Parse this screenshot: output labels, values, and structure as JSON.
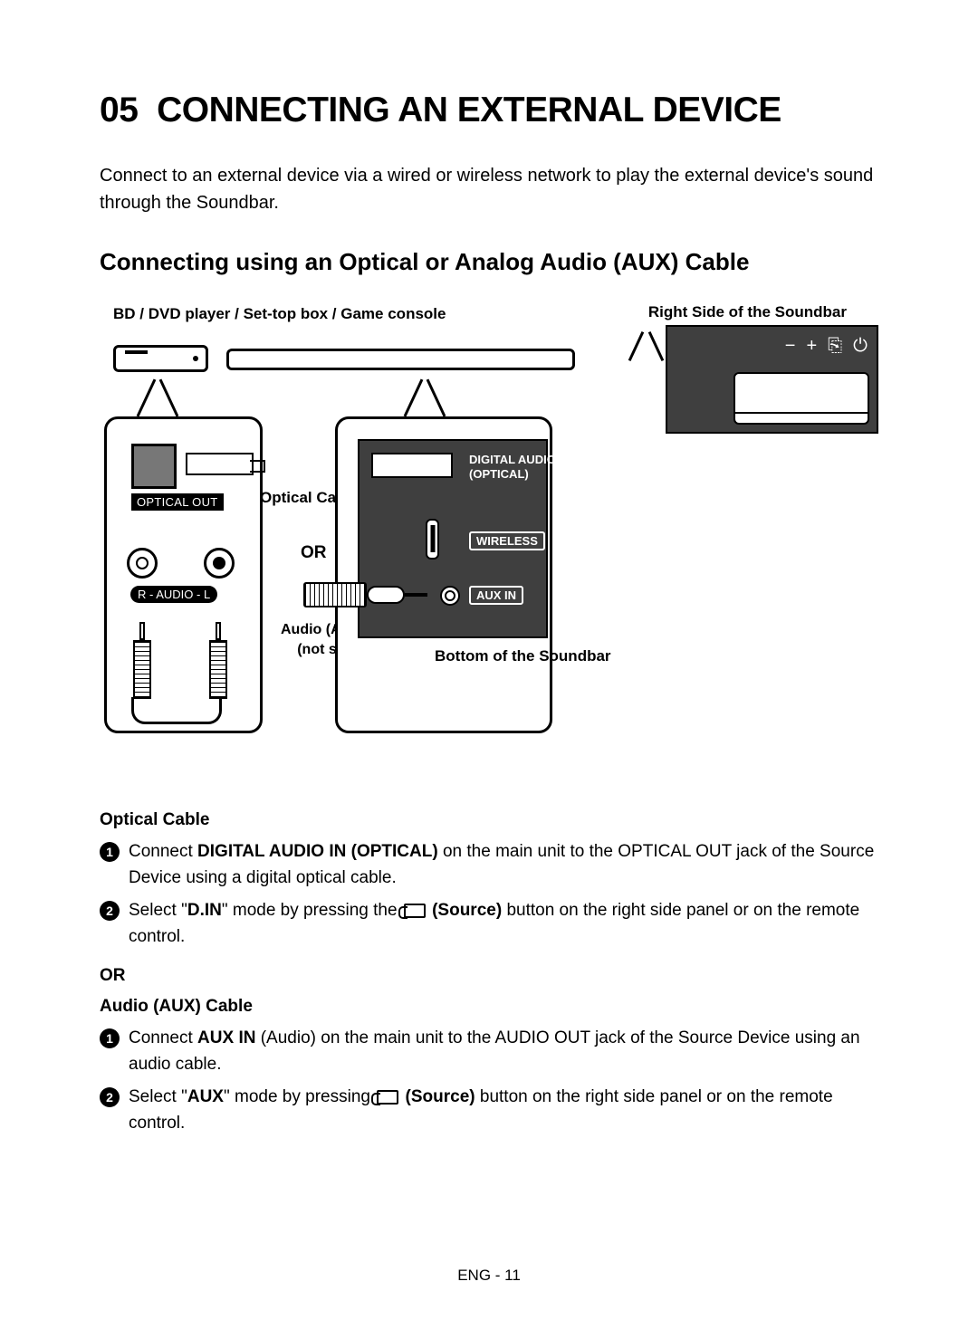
{
  "chapter": {
    "number": "05",
    "title": "CONNECTING AN EXTERNAL DEVICE"
  },
  "intro": "Connect to an external device via a wired or wireless network to play the external device's sound through the Soundbar.",
  "section_heading": "Connecting using an Optical or Analog Audio (AUX) Cable",
  "diagram": {
    "devices_label": "BD / DVD player / Set-top box / Game console",
    "right_side_label": "Right Side of the Soundbar",
    "bottom_label": "Bottom of the Soundbar",
    "optical_cable": "Optical Cable",
    "aux_cable_line1": "Audio (AUX) Cable",
    "aux_cable_line2": "(not supplied)",
    "or": "OR",
    "optical_out": "OPTICAL OUT",
    "audio_rl": "R - AUDIO - L",
    "digital_audio_in": "DIGITAL AUDIO IN",
    "optical_paren": "(OPTICAL)",
    "wireless": "WIRELESS",
    "aux_in": "AUX IN",
    "right_buttons": [
      "−",
      "+",
      "⎘",
      "⏻"
    ]
  },
  "optical_section": {
    "heading": "Optical Cable",
    "step1_pre": "Connect ",
    "step1_bold": "DIGITAL AUDIO IN (OPTICAL)",
    "step1_post": " on the main unit to the OPTICAL OUT jack of the Source Device using a digital optical cable.",
    "step2_pre": "Select \"",
    "step2_bold1": "D.IN",
    "step2_mid": "\" mode by pressing the ",
    "step2_bold2": "(Source)",
    "step2_post": " button on the right side panel or on the remote control."
  },
  "or_text": "OR",
  "aux_section": {
    "heading": "Audio (AUX) Cable",
    "step1_pre": "Connect ",
    "step1_bold": "AUX IN",
    "step1_post": " (Audio) on the main unit to the AUDIO OUT jack of the Source Device using an audio cable.",
    "step2_pre": "Select \"",
    "step2_bold1": "AUX",
    "step2_mid": "\" mode by pressing ",
    "step2_bold2": "(Source)",
    "step2_post": " button on the right side panel or on the remote control."
  },
  "page_number": "ENG - 11"
}
